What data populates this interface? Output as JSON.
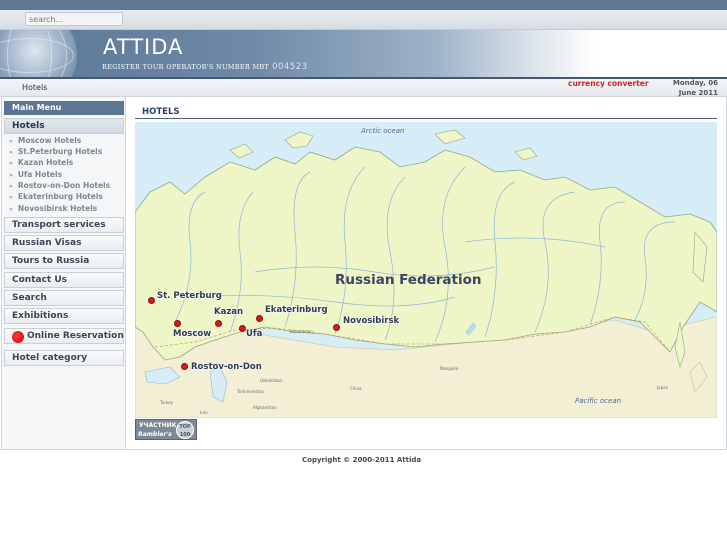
{
  "search": {
    "placeholder": "search..."
  },
  "header": {
    "brand": "ATTIDA",
    "tagline": "REGISTER TOUR OPERATOR'S NUMBER MBT",
    "register_number": "004523"
  },
  "breadcrumb": {
    "current": "Hotels"
  },
  "topbar": {
    "currency_link": "currency converter",
    "date_line1": "Monday, 06",
    "date_line2": "June 2011"
  },
  "sidebar": {
    "heading": "Main Menu",
    "hotels_label": "Hotels",
    "hotel_links": [
      "Moscow Hotels",
      "St.Peterburg Hotels",
      "Kazan Hotels",
      "Ufa Hotels",
      "Rostov-on-Don Hotels",
      "Ekaterinburg Hotels",
      "Novosibirsk Hotels"
    ],
    "items": [
      "Transport services",
      "Russian Visas",
      "Tours to Russia",
      "Contact Us",
      "Search",
      "Exhibitions",
      "Online Reservation",
      "Hotel category"
    ]
  },
  "main": {
    "section_title": "HOTELS",
    "map": {
      "country": "Russian Federation",
      "oceans": [
        "Arctic ocean",
        "Pacific ocean"
      ],
      "cities": [
        "St. Peterburg",
        "Moscow",
        "Kazan",
        "Ufa",
        "Ekaterinburg",
        "Novosibirsk",
        "Rostov-on-Don"
      ],
      "small_labels": [
        "Kazakhstan",
        "Mongolia",
        "China",
        "Japan",
        "Turkey",
        "Iran",
        "Uzbekistan",
        "Turkmenistan",
        "Afghanistan"
      ]
    }
  },
  "badge": {
    "line1": "УЧАСТНИК",
    "line2": "Rambler's",
    "top": "TOP 100"
  },
  "footer": {
    "copyright": "Copyright © 2000-2011  Attida"
  },
  "colors": {
    "header_bar": "#5f7894",
    "menu_heading": "#5c7593",
    "currency_link": "#d62020",
    "city_marker": "#d9181f",
    "land": "#eef6c8",
    "water": "#d6ecf7"
  }
}
